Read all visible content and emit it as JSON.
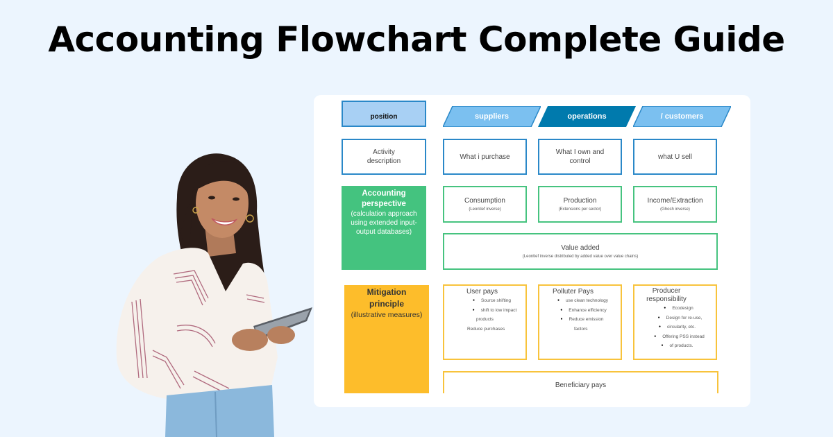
{
  "title": "Accounting Flowchart Complete Guide",
  "colors": {
    "background": "#ecf5fe",
    "blue_accent": "#2a88c8",
    "blue_light": "#7bc0f0",
    "blue_dark": "#007aad",
    "green": "#44c37f",
    "yellow": "#fdbd2b"
  },
  "diagram": {
    "header_row": {
      "label": "position",
      "columns": [
        {
          "label": "suppliers",
          "style": "light"
        },
        {
          "label": "operations",
          "style": "dark"
        },
        {
          "label": "/ customers",
          "style": "light"
        }
      ]
    },
    "activity_row": {
      "label": "Activity description",
      "cells": [
        "What i purchase",
        "What I own and control",
        "what U sell"
      ]
    },
    "accounting_row": {
      "label_title": "Accounting perspective",
      "label_sub": "(calculation approach using extended input-output databases)",
      "cells": [
        {
          "title": "Consumption",
          "sub": "(Leontief inverse)"
        },
        {
          "title": "Production",
          "sub": "(Extensions per sector)"
        },
        {
          "title": "Income/Extraction",
          "sub": "(Ghosh inverse)"
        }
      ],
      "wide_cell": {
        "title": "Value added",
        "sub": "(Leontief inverse distributed by added value over value chains)"
      }
    },
    "mitigation_row": {
      "label_title": "Mitigation principle",
      "label_sub": "(illustrative measures)",
      "cells": [
        {
          "title": "User pays",
          "items": [
            "Source shifting",
            "shift to low impact",
            "products",
            "Reduce purchases"
          ]
        },
        {
          "title": "Polluter Pays",
          "items": [
            "use clean technology",
            "Enhance efficiency",
            "Reduce emission",
            "factors"
          ]
        },
        {
          "title": "Producer responsibility",
          "items": [
            "Ecodesign",
            "Design for re-use,",
            "circularity, etc.",
            "Offering PSS instead",
            "of products."
          ]
        }
      ],
      "wide_cell": {
        "title": "Beneficiary pays"
      }
    }
  },
  "photo": {
    "description": "smiling woman holding a tablet"
  }
}
